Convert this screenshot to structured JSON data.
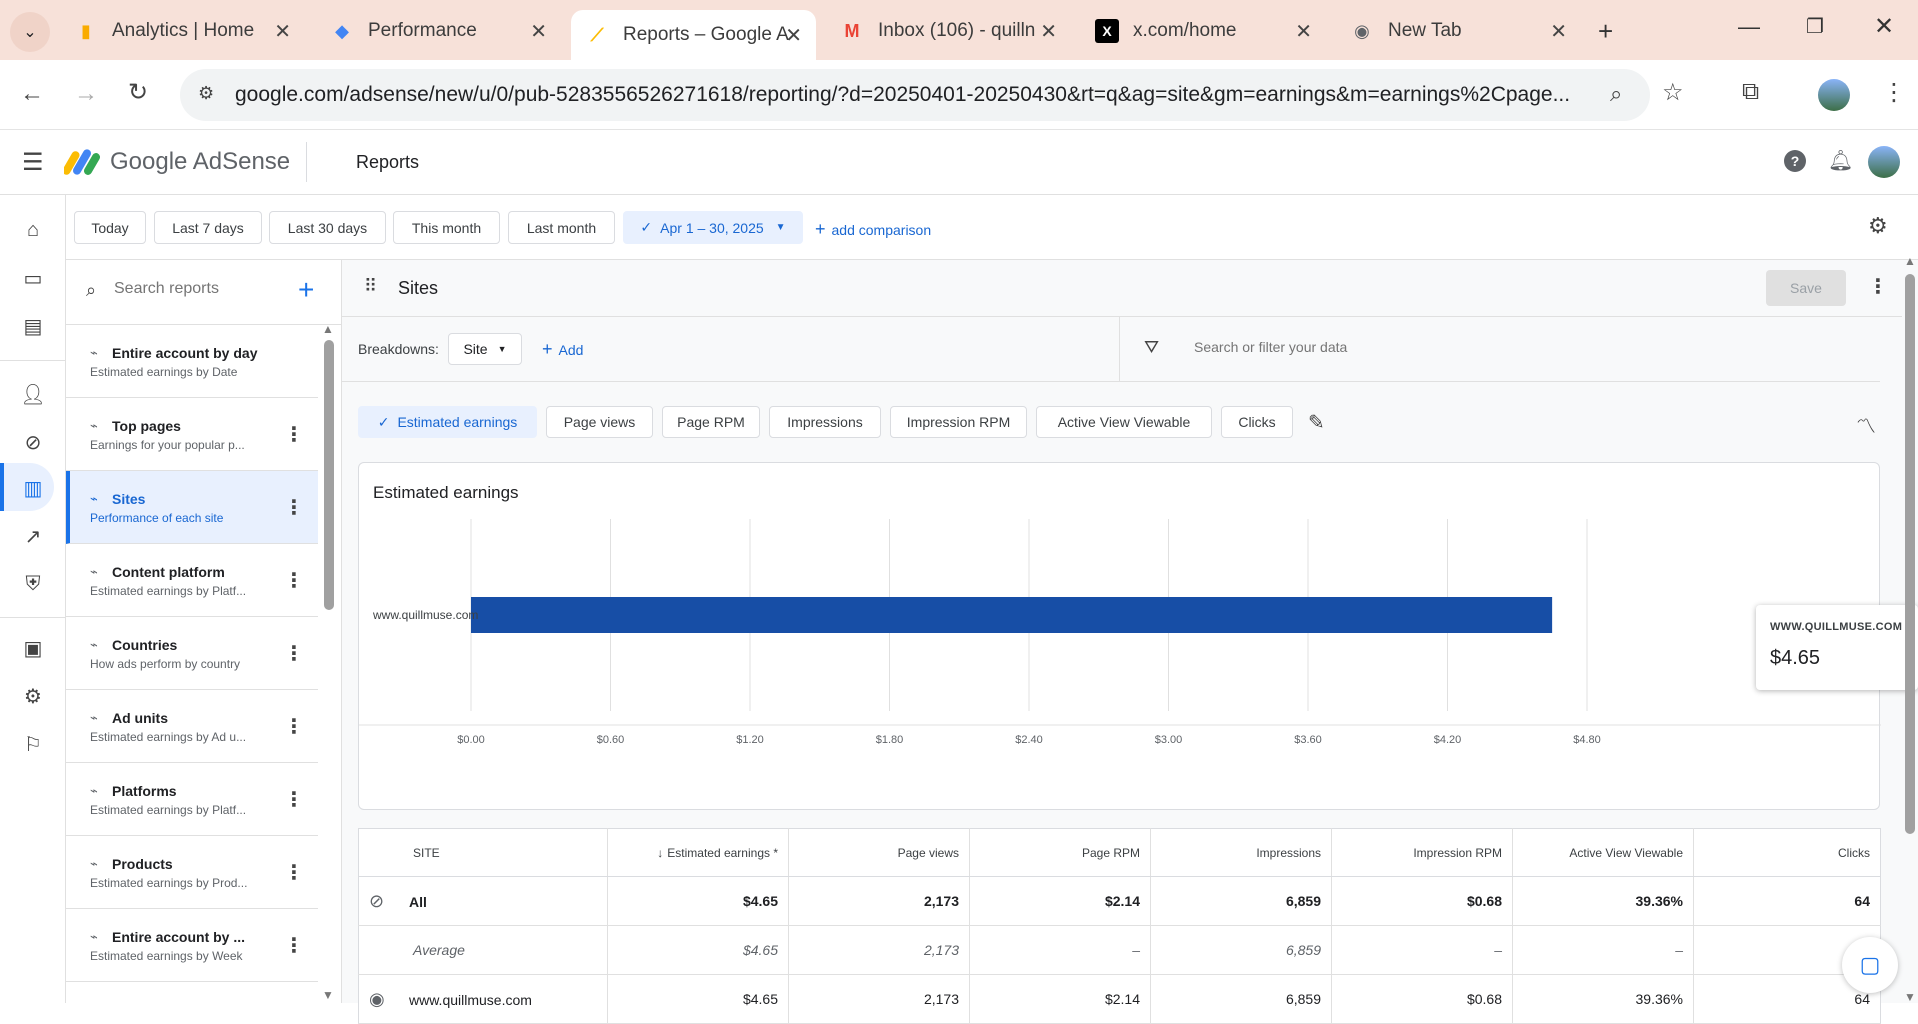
{
  "browser": {
    "tabs": [
      {
        "title": "Analytics | Home",
        "icon": "analytics-icon"
      },
      {
        "title": "Performance",
        "icon": "search-console-icon"
      },
      {
        "title": "Reports – Google A",
        "icon": "adsense-icon",
        "active": true
      },
      {
        "title": "Inbox (106) - quilln",
        "icon": "gmail-icon"
      },
      {
        "title": "x.com/home",
        "icon": "x-icon"
      },
      {
        "title": "New Tab",
        "icon": "chrome-icon"
      }
    ],
    "url": "google.com/adsense/new/u/0/pub-5283556526271618/reporting/?d=20250401-20250430&rt=q&ag=site&gm=earnings&m=earnings%2Cpage..."
  },
  "header": {
    "brand": "Google AdSense",
    "page_title": "Reports"
  },
  "datebar": {
    "presets": [
      "Today",
      "Last 7 days",
      "Last 30 days",
      "This month",
      "Last month"
    ],
    "selected_range": "Apr 1 – 30, 2025",
    "add_comparison": "add comparison"
  },
  "sidebar": {
    "search_placeholder": "Search reports",
    "items": [
      {
        "title": "Entire account by day",
        "subtitle": "Estimated earnings by Date"
      },
      {
        "title": "Top pages",
        "subtitle": "Earnings for your popular p..."
      },
      {
        "title": "Sites",
        "subtitle": "Performance of each site",
        "active": true
      },
      {
        "title": "Content platform",
        "subtitle": "Estimated earnings by Platf..."
      },
      {
        "title": "Countries",
        "subtitle": "How ads perform by country"
      },
      {
        "title": "Ad units",
        "subtitle": "Estimated earnings by Ad u..."
      },
      {
        "title": "Platforms",
        "subtitle": "Estimated earnings by Platf..."
      },
      {
        "title": "Products",
        "subtitle": "Estimated earnings by Prod..."
      },
      {
        "title": "Entire account by ...",
        "subtitle": "Estimated earnings by Week"
      }
    ]
  },
  "report": {
    "title": "Sites",
    "save_label": "Save",
    "breakdowns_label": "Breakdowns:",
    "breakdown_value": "Site",
    "add_label": "Add",
    "filter_placeholder": "Search or filter your data",
    "metrics": [
      "Estimated earnings",
      "Page views",
      "Page RPM",
      "Impressions",
      "Impression RPM",
      "Active View Viewable",
      "Clicks"
    ],
    "selected_metric": "Estimated earnings"
  },
  "chart_data": {
    "type": "bar",
    "orientation": "horizontal",
    "title": "Estimated earnings",
    "categories": [
      "www.quillmuse.com"
    ],
    "values": [
      4.65
    ],
    "xlim": [
      0,
      4.8
    ],
    "x_ticks": [
      "$0.00",
      "$0.60",
      "$1.20",
      "$1.80",
      "$2.40",
      "$3.00",
      "$3.60",
      "$4.20",
      "$4.80"
    ],
    "x_tick_values": [
      0,
      0.6,
      1.2,
      1.8,
      2.4,
      3.0,
      3.6,
      4.2,
      4.8
    ],
    "grid": true,
    "bar_color": "#174ea6",
    "tooltip": {
      "label": "WWW.QUILLMUSE.COM",
      "value": "$4.65"
    }
  },
  "table": {
    "columns": [
      "SITE",
      "Estimated earnings *",
      "Page views",
      "Page RPM",
      "Impressions",
      "Impression RPM",
      "Active View Viewable",
      "Clicks"
    ],
    "rows": [
      {
        "type": "total",
        "cells": [
          "All",
          "$4.65",
          "2,173",
          "$2.14",
          "6,859",
          "$0.68",
          "39.36%",
          "64"
        ]
      },
      {
        "type": "avg",
        "cells": [
          "Average",
          "$4.65",
          "2,173",
          "–",
          "6,859",
          "–",
          "–",
          ""
        ]
      },
      {
        "type": "row",
        "cells": [
          "www.quillmuse.com",
          "$4.65",
          "2,173",
          "$2.14",
          "6,859",
          "$0.68",
          "39.36%",
          "64"
        ]
      }
    ]
  },
  "colors": {
    "accent": "#1a73e8",
    "bar": "#174ea6",
    "tab_strip": "#f7e1d9"
  }
}
